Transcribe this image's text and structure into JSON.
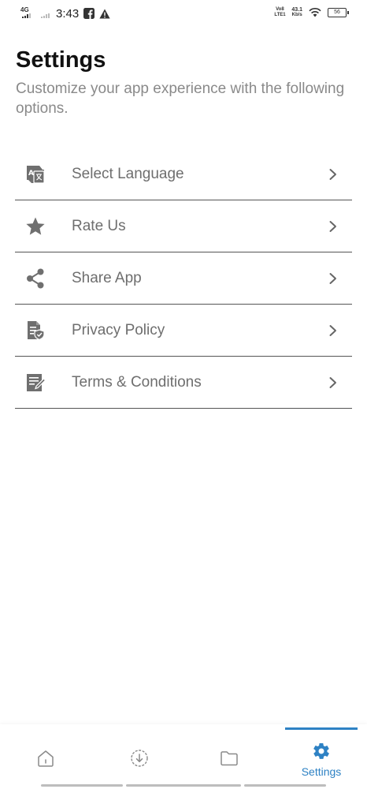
{
  "status_bar": {
    "network": "4G",
    "time": "3:43",
    "volte": "Vo8 LTE1",
    "speed_value": "43.1",
    "speed_unit": "Kb/s",
    "battery": "56"
  },
  "header": {
    "title": "Settings",
    "subtitle": "Customize your app experience with the following options."
  },
  "settings": {
    "items": [
      {
        "label": "Select Language",
        "icon": "translate-icon"
      },
      {
        "label": "Rate Us",
        "icon": "star-icon"
      },
      {
        "label": "Share App",
        "icon": "share-icon"
      },
      {
        "label": "Privacy Policy",
        "icon": "privacy-document-icon"
      },
      {
        "label": "Terms & Conditions",
        "icon": "terms-document-icon"
      }
    ]
  },
  "bottom_nav": {
    "items": [
      {
        "icon": "home-icon"
      },
      {
        "icon": "download-icon"
      },
      {
        "icon": "folder-icon"
      },
      {
        "icon": "gear-icon",
        "label": "Settings",
        "active": true
      }
    ]
  },
  "colors": {
    "accent": "#2e82c4",
    "icon_gray": "#6f6f6f",
    "label_gray": "#6e6e6e",
    "subtitle_gray": "#8a8a8a"
  }
}
